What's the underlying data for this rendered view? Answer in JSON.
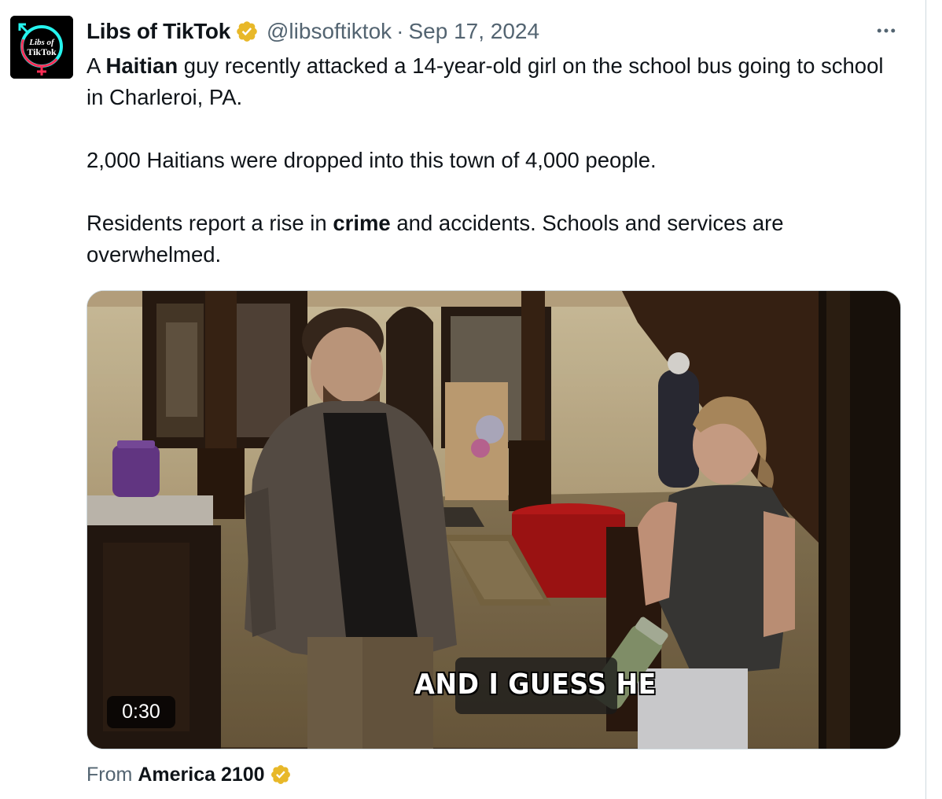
{
  "author": {
    "name": "Libs of TikTok",
    "handle": "@libsoftiktok",
    "date": "Sep 17, 2024",
    "avatar_text_top": "Libs of",
    "avatar_text_bottom": "TikTok",
    "verified_icon": "gold-verified-badge"
  },
  "tweet": {
    "p1_a": "A ",
    "p1_bold": "Haitian",
    "p1_b": " guy recently attacked a 14-year-old girl on the school bus going to school in Charleroi, PA.",
    "p2": "2,000 Haitians were dropped into this town of 4,000 people.",
    "p3_a": "Residents report a rise in ",
    "p3_bold": "crime",
    "p3_b": " and accidents. Schools and services are overwhelmed."
  },
  "video": {
    "subtitle": "AND I GUESS HE",
    "duration": "0:30"
  },
  "attribution": {
    "prefix": "From",
    "source": "America 2100",
    "verified_icon": "gold-verified-badge"
  },
  "more_icon": "more-horizontal-icon",
  "colors": {
    "text": "#0f1419",
    "secondary": "#536471",
    "verified_gold": "#e8b829",
    "border": "#cfd9de"
  }
}
